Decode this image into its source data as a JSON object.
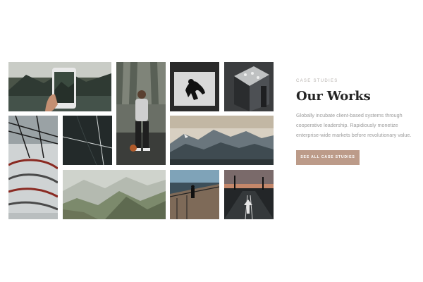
{
  "section": {
    "eyebrow": "CASE STUDIES",
    "title": "Our Works",
    "description": "Globally incubate client-based systems through cooperative leadership. Rapidiously monetize enterprise-wide markets before revolutionary value.",
    "cta_label": "SEE ALL CASE STUDIES",
    "accent_color": "#bc9b89"
  },
  "gallery": {
    "images": [
      {
        "name": "phone-mountain-lake-photo"
      },
      {
        "name": "basketball-player-photo"
      },
      {
        "name": "skateboarder-silhouette-photo"
      },
      {
        "name": "rooftop-aerial-photo"
      },
      {
        "name": "spiral-architecture-photo"
      },
      {
        "name": "dark-court-lines-photo"
      },
      {
        "name": "snowy-mountain-range-photo"
      },
      {
        "name": "misty-mountain-valley-photo"
      },
      {
        "name": "skateboard-bridge-photo"
      },
      {
        "name": "road-arrow-sunset-photo"
      }
    ]
  }
}
